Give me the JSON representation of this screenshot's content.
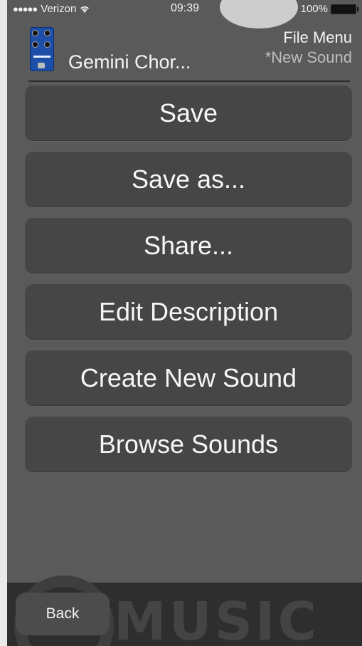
{
  "status_bar": {
    "carrier": "Verizon",
    "signal_dots": "●●●●●",
    "time": "09:39",
    "battery_percent": "100%"
  },
  "header": {
    "device_name": "Gemini Chor...",
    "menu_title": "File Menu",
    "sound_name": "*New Sound"
  },
  "menu": {
    "items": [
      {
        "label": "Save"
      },
      {
        "label": "Save as..."
      },
      {
        "label": "Share..."
      },
      {
        "label": "Edit Description"
      },
      {
        "label": "Create New Sound"
      },
      {
        "label": "Browse Sounds"
      }
    ]
  },
  "bottom_bar": {
    "back_label": "Back",
    "watermark_text": "MUSIC"
  },
  "colors": {
    "screen_background": "#5a5a5a",
    "button_background": "#464646",
    "bottom_bar": "#2e2e2e",
    "pedal_blue": "#1d4fa8"
  }
}
